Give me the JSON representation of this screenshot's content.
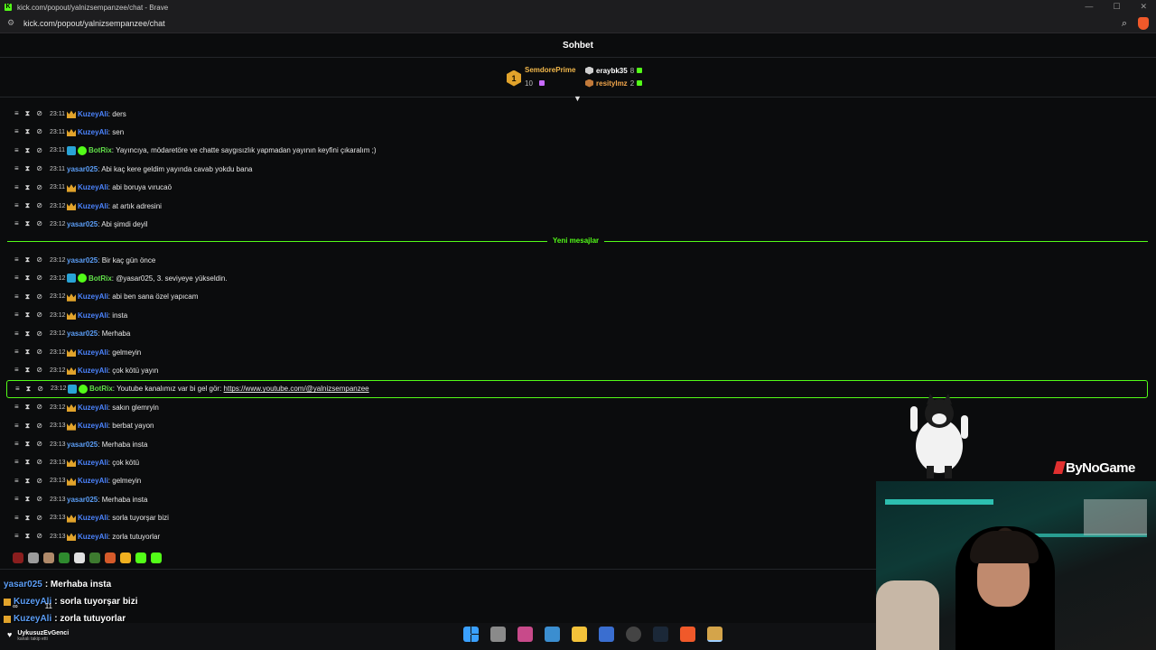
{
  "browser": {
    "tab_title": "kick.com/popout/yalnizsempanzee/chat - Brave",
    "url": "kick.com/popout/yalnizsempanzee/chat"
  },
  "chat": {
    "title": "Sohbet",
    "leaderboard": {
      "rank": "1",
      "top_name": "SemdorePrime",
      "top_count": "10",
      "others": [
        {
          "name": "eraybk35",
          "count": "8",
          "color": "#ffffff",
          "medal": "#cfcfcf"
        },
        {
          "name": "resitylmz",
          "count": "2",
          "color": "#f2a64b",
          "medal": "#c27a3a"
        }
      ]
    },
    "new_messages_label": "Yeni mesajlar",
    "messages_before": [
      {
        "time": "23:11",
        "badges": [
          "crown"
        ],
        "user": "KuzeyAli",
        "ucls": "u-kuzey",
        "text": ": ders"
      },
      {
        "time": "23:11",
        "badges": [
          "crown"
        ],
        "user": "KuzeyAli",
        "ucls": "u-kuzey",
        "text": ": sen"
      },
      {
        "time": "23:11",
        "badges": [
          "bot",
          "verified"
        ],
        "user": "BotRix",
        "ucls": "u-botrix",
        "text": ": Yayıncıya, mödaretöre ve chatte saygısızlık yapmadan yayının keyfini çıkaralım ;)"
      },
      {
        "time": "23:11",
        "badges": [],
        "user": "yasar025",
        "ucls": "u-yasar",
        "text": ": Abi kaç kere geldim yayında cavab yokdu bana"
      },
      {
        "time": "23:11",
        "badges": [
          "crown"
        ],
        "user": "KuzeyAli",
        "ucls": "u-kuzey",
        "text": ": abi boruya vırucaö"
      },
      {
        "time": "23:12",
        "badges": [
          "crown"
        ],
        "user": "KuzeyAli",
        "ucls": "u-kuzey",
        "text": ": at artık adresini"
      },
      {
        "time": "23:12",
        "badges": [],
        "user": "yasar025",
        "ucls": "u-yasar",
        "text": ": Abi şimdi deyil"
      }
    ],
    "messages_after": [
      {
        "time": "23:12",
        "badges": [],
        "user": "yasar025",
        "ucls": "u-yasar",
        "text": ": Bir kaç gün önce"
      },
      {
        "time": "23:12",
        "badges": [
          "bot",
          "verified"
        ],
        "user": "BotRix",
        "ucls": "u-botrix",
        "text": ": @yasar025, 3. seviyeye yükseldin."
      },
      {
        "time": "23:12",
        "badges": [
          "crown"
        ],
        "user": "KuzeyAli",
        "ucls": "u-kuzey",
        "text": ": abi ben sana özel yapıcam"
      },
      {
        "time": "23:12",
        "badges": [
          "crown"
        ],
        "user": "KuzeyAli",
        "ucls": "u-kuzey",
        "text": ": insta"
      },
      {
        "time": "23:12",
        "badges": [],
        "user": "yasar025",
        "ucls": "u-yasar",
        "text": ": Merhaba"
      },
      {
        "time": "23:12",
        "badges": [
          "crown"
        ],
        "user": "KuzeyAli",
        "ucls": "u-kuzey",
        "text": ": gelmeyin"
      },
      {
        "time": "23:12",
        "badges": [
          "crown"
        ],
        "user": "KuzeyAli",
        "ucls": "u-kuzey",
        "text": ": çok kötü yayın"
      },
      {
        "time": "23:12",
        "badges": [
          "bot",
          "verified"
        ],
        "user": "BotRix",
        "ucls": "u-botrix",
        "text": ": Youtube kanalımız var bi gel gör: ",
        "link": "https://www.youtube.com/@yalnizsempanzee",
        "highlight": true
      },
      {
        "time": "23:12",
        "badges": [
          "crown"
        ],
        "user": "KuzeyAli",
        "ucls": "u-kuzey",
        "text": ": sakın glemryin"
      },
      {
        "time": "23:13",
        "badges": [
          "crown"
        ],
        "user": "KuzeyAli",
        "ucls": "u-kuzey",
        "text": ": berbat yayon"
      },
      {
        "time": "23:13",
        "badges": [],
        "user": "yasar025",
        "ucls": "u-yasar",
        "text": ": Merhaba insta"
      },
      {
        "time": "23:13",
        "badges": [
          "crown"
        ],
        "user": "KuzeyAli",
        "ucls": "u-kuzey",
        "text": ": çok kötü"
      },
      {
        "time": "23:13",
        "badges": [
          "crown"
        ],
        "user": "KuzeyAli",
        "ucls": "u-kuzey",
        "text": ": gelmeyin"
      },
      {
        "time": "23:13",
        "badges": [],
        "user": "yasar025",
        "ucls": "u-yasar",
        "text": ": Merhaba insta"
      },
      {
        "time": "23:13",
        "badges": [
          "crown"
        ],
        "user": "KuzeyAli",
        "ucls": "u-kuzey",
        "text": ": sorla tuyorşar bizi"
      },
      {
        "time": "23:13",
        "badges": [
          "crown"
        ],
        "user": "KuzeyAli",
        "ucls": "u-kuzey",
        "text": ": zorla tutuyorlar"
      }
    ],
    "emote_colors": [
      "#8a1e1e",
      "#9c9c9c",
      "#b08a6a",
      "#2e8a2e",
      "#e0e0e0",
      "#3d7a2f",
      "#d55a2a",
      "#f0b020",
      "#53fc18",
      "#53fc18"
    ]
  },
  "stream_overlay": {
    "chat_lines": [
      {
        "user": "yasar025",
        "text": ": Merhaba insta"
      },
      {
        "user": "KuzeyAli",
        "text": ": sorla tuyorşar bizi"
      },
      {
        "user": "KuzeyAli",
        "text": ": zorla tutuyorlar"
      }
    ],
    "stat_1": "∞",
    "stat_2": "11",
    "brand": "ByNoGame",
    "follower_name": "UykusuzEvGenci",
    "follower_sub": "kanalı takip etti"
  }
}
